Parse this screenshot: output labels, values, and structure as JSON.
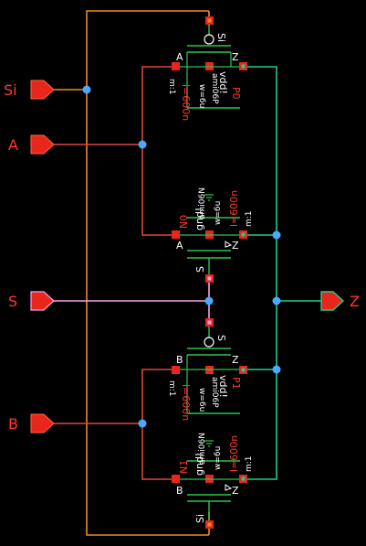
{
  "colors": {
    "background": "#000000",
    "wire_orange": "#f08a24",
    "wire_red": "#e0463c",
    "wire_green": "#1ccf8a",
    "wire_pink": "#f7a3ee",
    "device_green": "#2cc44e",
    "pin_red": "#e8261b",
    "pin_text": "#ff3a2a",
    "junction_blue": "#4aa8ff",
    "white": "#ffffff"
  },
  "pins": {
    "si": "Si",
    "a": "A",
    "s": "S",
    "b": "B",
    "z": "Z"
  },
  "transistors": {
    "p0": {
      "name": "P0",
      "model": "ami06P",
      "width": "w=6u",
      "length": "l=600n",
      "mult": "m:1",
      "bulk": "vdd!",
      "gate": "Si",
      "drain": "A",
      "source": "Z"
    },
    "n0": {
      "name": "N0",
      "model": "ami06N",
      "width": "w=6u",
      "length": "l=600n",
      "mult": "m:1",
      "bulk": "gnd!",
      "gate": "S",
      "drain": "A",
      "source": "Z"
    },
    "p1": {
      "name": "P1",
      "model": "ami06P",
      "width": "w=6u",
      "length": "l=600n",
      "mult": "m:1",
      "bulk": "vdd!",
      "gate": "S",
      "drain": "B",
      "source": "Z"
    },
    "n1": {
      "name": "N1",
      "model": "ami06N",
      "width": "w=6u",
      "length": "l=600n",
      "mult": "m:1",
      "bulk": "gnd!",
      "gate": "Si",
      "drain": "B",
      "source": "Z"
    }
  }
}
